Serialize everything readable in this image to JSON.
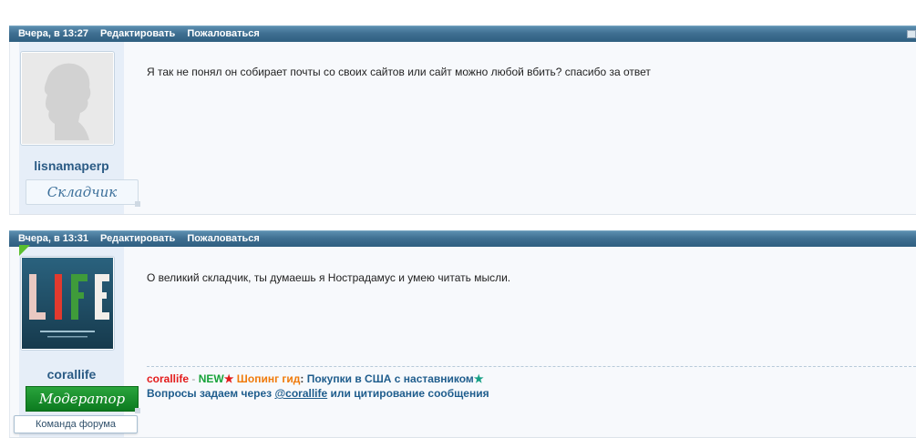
{
  "posts": [
    {
      "date": "Вчера, в 13:27",
      "edit": "Редактировать",
      "report": "Пожаловаться",
      "username": "lisnamaperp",
      "rank": "Складчик",
      "message": "Я так не понял он собирает почты со своих сайтов или сайт можно любой вбить? спасибо за ответ"
    },
    {
      "date": "Вчера, в 13:31",
      "edit": "Редактировать",
      "report": "Пожаловаться",
      "username": "corallife",
      "rank": "Модератор",
      "team": "Команда форума",
      "avatar_text": "LIFE",
      "message": "О великий складчик, ты думаешь я Нострадамус и умею читать мысли.",
      "signature": {
        "name": "corallife",
        "dash": " - ",
        "new": "NEW",
        "star": "★",
        "shop": " Шопинг гид",
        "colon": ":",
        "buy": " Покупки в США с наставником",
        "star2": "★",
        "line2_pre": "Вопросы задаем через ",
        "mention": "@corallife",
        "line2_post": " или цитирование сообщения"
      }
    }
  ],
  "colors": {
    "header": "#3f6f92",
    "username": "#2b5b85",
    "moderator": "#0c7a1f"
  },
  "icons": {
    "default_avatar": "person-silhouette-icon",
    "corner": "square-icon"
  }
}
